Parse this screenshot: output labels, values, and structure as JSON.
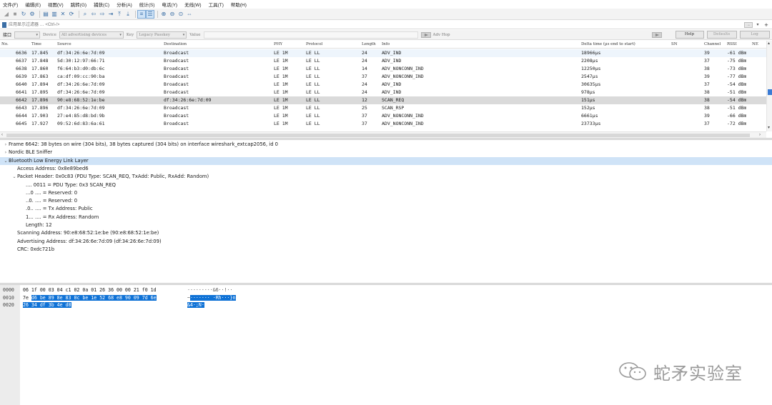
{
  "menu": [
    "文件(F)",
    "编辑(E)",
    "视图(V)",
    "跳转(G)",
    "捕获(C)",
    "分析(A)",
    "统计(S)",
    "电话(Y)",
    "无线(W)",
    "工具(T)",
    "帮助(H)"
  ],
  "toolbar_icons": [
    "shark-fin-start-icon",
    "stop-icon",
    "restart-icon",
    "options-gear-icon",
    "open-file-icon",
    "save-file-icon",
    "close-file-icon",
    "reload-icon",
    "find-icon",
    "go-back-icon",
    "go-forward-icon",
    "go-to-packet-icon",
    "go-first-icon",
    "go-last-icon",
    "autoscroll-icon",
    "colorize-icon",
    "zoom-in-icon",
    "zoom-out-icon",
    "zoom-normal-icon",
    "resize-columns-icon"
  ],
  "filter": {
    "placeholder": "应用显示过滤器 … <Ctrl-/>"
  },
  "interface_bar": {
    "interface_label": "接口",
    "device_label": "Device",
    "device_value": "All advertising devices",
    "key_label": "Key",
    "key_value": "Legacy Passkey",
    "value_label": "Value",
    "adv_hop_label": "Adv Hop",
    "help_label": "Help",
    "defaults_label": "Defaults",
    "log_label": "Log"
  },
  "packet_list": {
    "columns": [
      "No.",
      "Time",
      "Source",
      "Destination",
      "PHY",
      "Protocol",
      "Length",
      "Info",
      "Delta time (µs end to start)",
      "SN",
      "Channel",
      "RSSI",
      "NE"
    ],
    "rows": [
      {
        "no": "6636",
        "time": "17.845",
        "source": "df:34:26:6e:7d:09",
        "destination": "Broadcast",
        "phy": "LE 1M",
        "protocol": "LE LL",
        "length": "24",
        "info": "ADV_IND",
        "delta": "18966µs",
        "sn": "",
        "channel": "39",
        "rssi": "-61 dBm"
      },
      {
        "no": "6637",
        "time": "17.848",
        "source": "5d:30:12:97:66:71",
        "destination": "Broadcast",
        "phy": "LE 1M",
        "protocol": "LE LL",
        "length": "24",
        "info": "ADV_IND",
        "delta": "2208µs",
        "sn": "",
        "channel": "37",
        "rssi": "-75 dBm"
      },
      {
        "no": "6638",
        "time": "17.860",
        "source": "f6:64:b3:d0:db:6c",
        "destination": "Broadcast",
        "phy": "LE 1M",
        "protocol": "LE LL",
        "length": "14",
        "info": "ADV_NONCONN_IND",
        "delta": "12250µs",
        "sn": "",
        "channel": "38",
        "rssi": "-73 dBm"
      },
      {
        "no": "6639",
        "time": "17.863",
        "source": "ca:df:09:cc:90:ba",
        "destination": "Broadcast",
        "phy": "LE 1M",
        "protocol": "LE LL",
        "length": "37",
        "info": "ADV_NONCONN_IND",
        "delta": "2547µs",
        "sn": "",
        "channel": "39",
        "rssi": "-77 dBm"
      },
      {
        "no": "6640",
        "time": "17.894",
        "source": "df:34:26:6e:7d:09",
        "destination": "Broadcast",
        "phy": "LE 1M",
        "protocol": "LE LL",
        "length": "24",
        "info": "ADV_IND",
        "delta": "30635µs",
        "sn": "",
        "channel": "37",
        "rssi": "-54 dBm"
      },
      {
        "no": "6641",
        "time": "17.895",
        "source": "df:34:26:6e:7d:09",
        "destination": "Broadcast",
        "phy": "LE 1M",
        "protocol": "LE LL",
        "length": "24",
        "info": "ADV_IND",
        "delta": "978µs",
        "sn": "",
        "channel": "38",
        "rssi": "-51 dBm"
      },
      {
        "no": "6642",
        "time": "17.896",
        "source": "90:e8:68:52:1e:be",
        "destination": "df:34:26:6e:7d:09",
        "phy": "LE 1M",
        "protocol": "LE LL",
        "length": "12",
        "info": "SCAN_REQ",
        "delta": "151µs",
        "sn": "",
        "channel": "38",
        "rssi": "-54 dBm"
      },
      {
        "no": "6643",
        "time": "17.896",
        "source": "df:34:26:6e:7d:09",
        "destination": "Broadcast",
        "phy": "LE 1M",
        "protocol": "LE LL",
        "length": "25",
        "info": "SCAN_RSP",
        "delta": "152µs",
        "sn": "",
        "channel": "38",
        "rssi": "-51 dBm"
      },
      {
        "no": "6644",
        "time": "17.903",
        "source": "27:e4:85:d8:bd:9b",
        "destination": "Broadcast",
        "phy": "LE 1M",
        "protocol": "LE LL",
        "length": "37",
        "info": "ADV_NONCONN_IND",
        "delta": "6661µs",
        "sn": "",
        "channel": "39",
        "rssi": "-66 dBm"
      },
      {
        "no": "6645",
        "time": "17.927",
        "source": "09:52:6d:83:6a:61",
        "destination": "Broadcast",
        "phy": "LE 1M",
        "protocol": "LE LL",
        "length": "37",
        "info": "ADV_NONCONN_IND",
        "delta": "23733µs",
        "sn": "",
        "channel": "37",
        "rssi": "-72 dBm"
      }
    ]
  },
  "details": [
    {
      "indent": 0,
      "toggle": "›",
      "text": "Frame 6642: 38 bytes on wire (304 bits), 38 bytes captured (304 bits) on interface wireshark_extcap2056, id 0"
    },
    {
      "indent": 0,
      "toggle": "›",
      "text": "Nordic BLE Sniffer"
    },
    {
      "indent": 0,
      "toggle": "⌄",
      "text": "Bluetooth Low Energy Link Layer"
    },
    {
      "indent": 1,
      "toggle": "",
      "text": "Access Address: 0x8e89bed6"
    },
    {
      "indent": 1,
      "toggle": "⌄",
      "text": "Packet Header: 0x0c83 (PDU Type: SCAN_REQ, TxAdd: Public, RxAdd: Random)"
    },
    {
      "indent": 2,
      "toggle": "",
      "text": ".... 0011 = PDU Type: 0x3 SCAN_REQ"
    },
    {
      "indent": 2,
      "toggle": "",
      "text": "...0 .... = Reserved: 0"
    },
    {
      "indent": 2,
      "toggle": "",
      "text": "..0. .... = Reserved: 0"
    },
    {
      "indent": 2,
      "toggle": "",
      "text": ".0.. .... = Tx Address: Public"
    },
    {
      "indent": 2,
      "toggle": "",
      "text": "1... .... = Rx Address: Random"
    },
    {
      "indent": 2,
      "toggle": "",
      "text": "Length: 12"
    },
    {
      "indent": 1,
      "toggle": "",
      "text": "Scanning Address: 90:e8:68:52:1e:be (90:e8:68:52:1e:be)"
    },
    {
      "indent": 1,
      "toggle": "",
      "text": "Advertising Address: df:34:26:6e:7d:09 (df:34:26:6e:7d:09)"
    },
    {
      "indent": 1,
      "toggle": "",
      "text": "CRC: 0xdc721b"
    }
  ],
  "bytes": [
    {
      "offset": "0000",
      "hex_plain": "06 1f 00 03 04 c1 02 0a  01 26 36 00 00 21 f0 1d",
      "hex_hl": "",
      "ascii_plain": "·········&6··!··",
      "ascii_hl": ""
    },
    {
      "offset": "0010",
      "hex_plain": "7e ",
      "hex_hl": "d6 be 89 8e 83 0c be  1e 52 68 e8 90 09 7d 6e",
      "ascii_plain": "~",
      "ascii_hl": "······· ·Rh···}n"
    },
    {
      "offset": "0020",
      "hex_plain": "",
      "hex_hl": "26 34 df 3b 4e d8",
      "ascii_plain": "",
      "ascii_hl": "&4·;N·"
    }
  ],
  "watermark": {
    "text": "蛇矛实验室",
    "icon": "wechat-icon"
  },
  "colors": {
    "selection_blue": "#0f72d6",
    "detail_selected": "#cfe3f7",
    "packet_selected": "#dadada"
  }
}
